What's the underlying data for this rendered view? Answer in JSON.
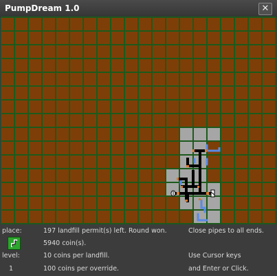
{
  "window": {
    "title": "PumpDream 1.0",
    "close_glyph": "✕"
  },
  "status": {
    "place_label": "place:",
    "permits": "197 landfill permit(s) left. Round won.",
    "goal": "Close pipes to all ends.",
    "coins": "5940 coin(s).",
    "level_label": "level:",
    "level_value": "1",
    "landfill_cost": "10 coins per landfill.",
    "override_cost": "100 coins per override.",
    "hint_line1": "Use Cursor keys",
    "hint_line2": "and Enter or Click."
  },
  "icons": {
    "tool": "pipe-tool-icon",
    "pump": "pump-icon",
    "valve": "valve-end-icon"
  },
  "colors": {
    "soil": "#7d3f07",
    "grid": "#1c5a1c",
    "landfill": "#a6a6a6",
    "pipe": "#000000",
    "water": "#5a8ae6",
    "fitting": "#d9792b",
    "tool_bg": "#2ea52e"
  },
  "board": {
    "cols": 20,
    "rows": 15,
    "landfill_cells": [
      [
        13,
        9
      ],
      [
        14,
        9
      ],
      [
        15,
        9
      ],
      [
        13,
        10
      ],
      [
        14,
        10
      ],
      [
        13,
        11
      ],
      [
        14,
        11
      ],
      [
        12,
        12
      ],
      [
        13,
        12
      ],
      [
        14,
        12
      ],
      [
        12,
        13
      ],
      [
        13,
        13
      ],
      [
        14,
        13
      ],
      [
        15,
        13
      ],
      [
        13,
        14
      ],
      [
        14,
        14
      ],
      [
        15,
        14
      ],
      [
        14,
        15
      ],
      [
        15,
        15
      ]
    ]
  }
}
